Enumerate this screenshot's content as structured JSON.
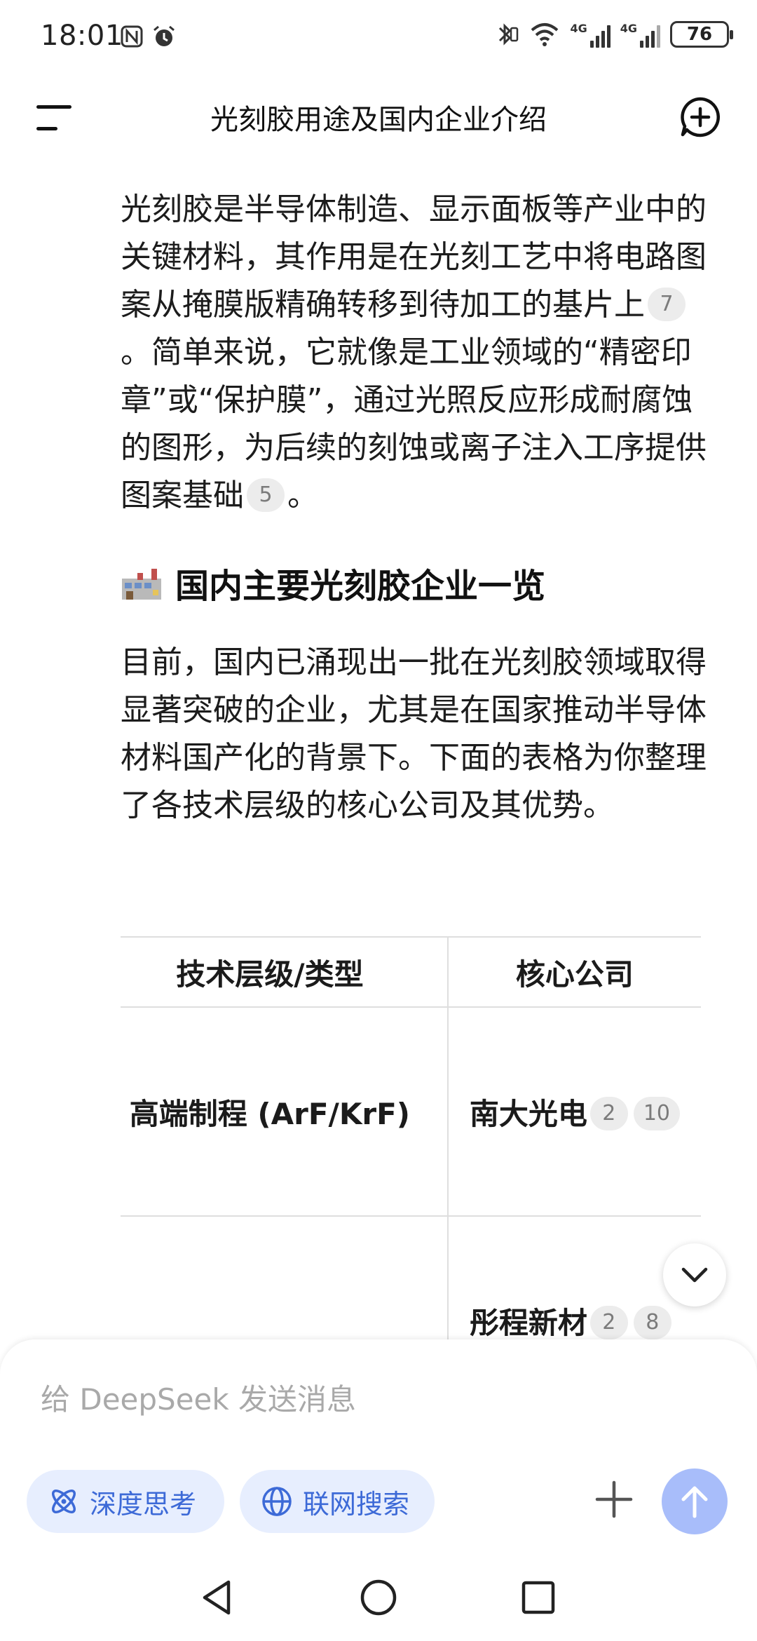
{
  "status_bar": {
    "time": "18:01",
    "left_icons": [
      "nfc-icon",
      "alarm-icon"
    ],
    "right_icons": [
      "bluetooth-vibrate-icon",
      "wifi-icon",
      "signal-4g-icon",
      "signal-4g-icon"
    ],
    "network_label_1": "4G",
    "network_label_2": "4G",
    "battery": "76"
  },
  "header": {
    "title": "光刻胶用途及国内企业介绍",
    "menu_icon": "menu-icon",
    "new_chat_icon": "new-chat-icon"
  },
  "content": {
    "intro_part1": "光刻胶是半导体制造、显示面板等产业中的关键材料，其作用是在光刻工艺中将电路图案从掩膜版精确转移到待加工的基片上",
    "intro_cite1": "7",
    "intro_part2": "。简单来说，它就像是工业领域的“精密印章”或“保护膜”，通过光照反应形成耐腐蚀的图形，为后续的刻蚀或离子注入工序提供图案基础",
    "intro_cite2": "5",
    "intro_part3": "。",
    "section_emoji": "factory-icon",
    "section_heading": "国内主要光刻胶企业一览",
    "section_para": "目前，国内已涌现出一批在光刻胶领域取得显著突破的企业，尤其是在国家推动半导体材料国产化的背景下。下面的表格为你整理了各技术层级的核心公司及其优势。"
  },
  "table": {
    "headers": [
      "技术层级/类型",
      "核心公司"
    ],
    "rows": [
      {
        "tier": "高端制程 (ArF/KrF)",
        "company": "南大光电",
        "cites": [
          "2",
          "10"
        ]
      },
      {
        "tier": "",
        "company": "彤程新材",
        "cites": [
          "2",
          "8"
        ]
      }
    ]
  },
  "input": {
    "placeholder": "给 DeepSeek 发送消息",
    "deep_think_label": "深度思考",
    "web_search_label": "联网搜索"
  },
  "colors": {
    "accent": "#3d6ad7",
    "pill_bg": "#e7eefe",
    "send_bg": "#a8bdfa",
    "cite_bg": "#ececec"
  }
}
